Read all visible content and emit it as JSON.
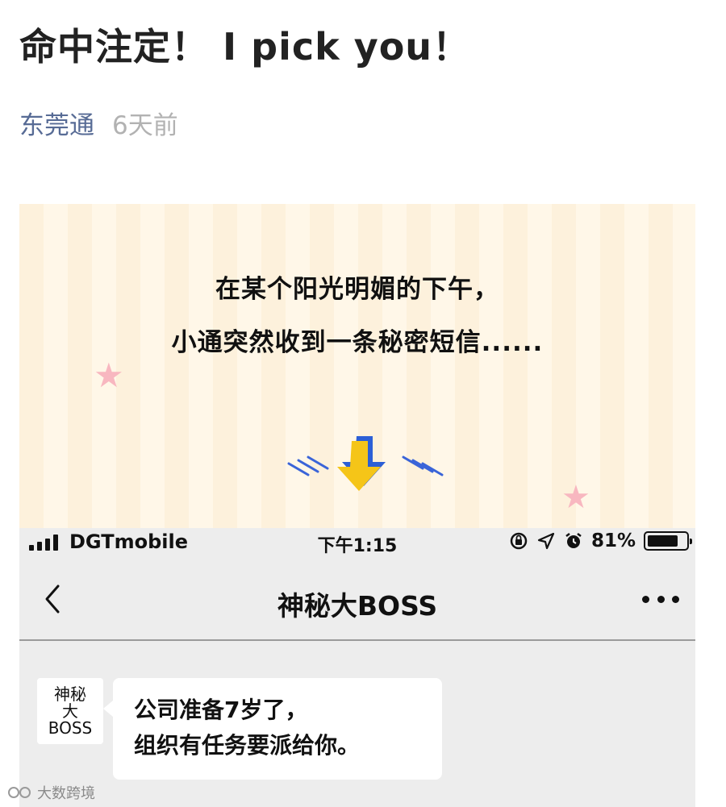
{
  "article": {
    "title": "命中注定！ I pick you！",
    "account": "东莞通",
    "time": "6天前"
  },
  "banner": {
    "line1": "在某个阳光明媚的下午，",
    "line2": "小通突然收到一条秘密短信......",
    "arrow_color": "#f5c518",
    "arrow_shadow_color": "#2c5fd6",
    "star_color": "#f8b7c0"
  },
  "phone": {
    "status": {
      "carrier": "DGTmobile",
      "time": "下午1:15",
      "battery": "81%",
      "battery_level": 0.81
    },
    "nav": {
      "title": "神秘大BOSS"
    },
    "message": {
      "avatar_line1": "神秘",
      "avatar_line2": "大",
      "avatar_line3": "BOSS",
      "text_line1": "公司准备7岁了，",
      "text_line2": "组织有任务要派给你。"
    }
  },
  "watermark": {
    "text": "大数跨境"
  }
}
